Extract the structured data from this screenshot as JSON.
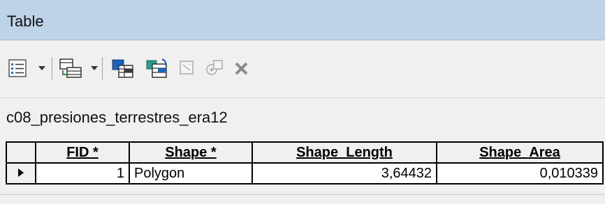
{
  "window": {
    "title": "Table"
  },
  "toolbar": {
    "icons": [
      "table-options-icon",
      "related-tables-icon",
      "select-by-attributes-icon",
      "switch-selection-icon",
      "clear-selection-icon",
      "zoom-to-selected-icon",
      "delete-selected-icon"
    ]
  },
  "layer": {
    "name": "c08_presiones_terrestres_era12"
  },
  "table": {
    "columns": [
      "FID *",
      "Shape *",
      "Shape_Length",
      "Shape_Area"
    ],
    "rows": [
      {
        "FID": "1",
        "Shape": "Polygon",
        "Shape_Length": "3,64432",
        "Shape_Area": "0,010339"
      }
    ]
  },
  "colors": {
    "titlebar": "#bfd3e8",
    "toolbar": "#f0f0f0",
    "delete": "#8a8a8a"
  }
}
